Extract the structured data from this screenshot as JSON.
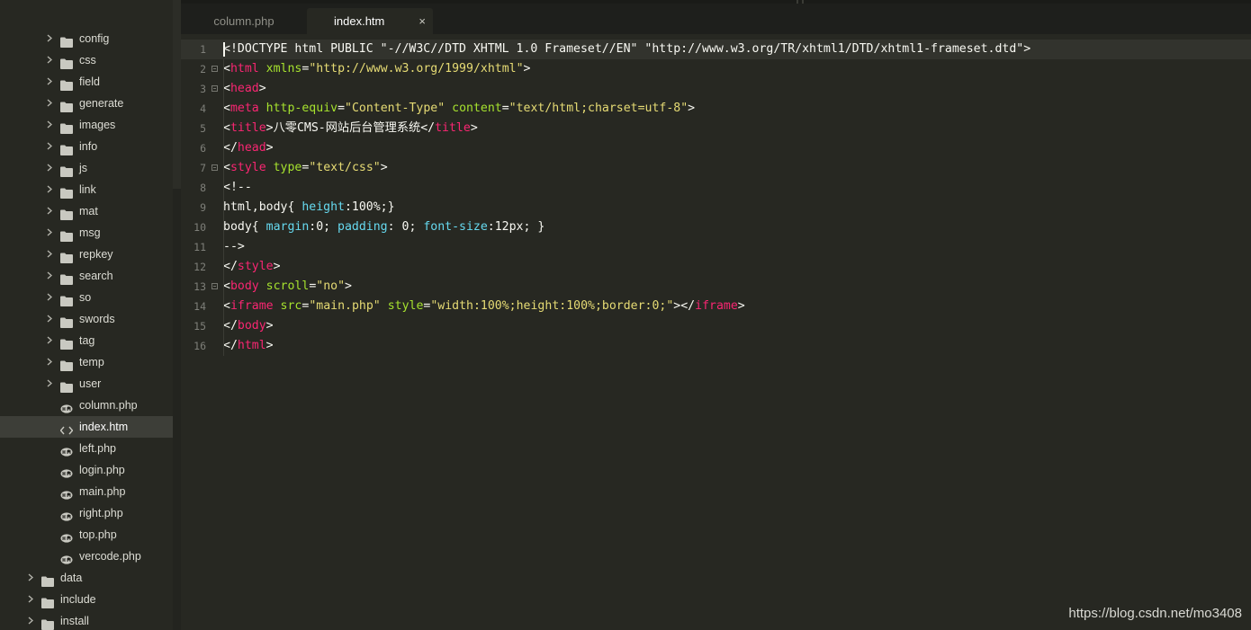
{
  "sidebar": {
    "items": [
      {
        "label": "config",
        "type": "folder",
        "depth": 1
      },
      {
        "label": "css",
        "type": "folder",
        "depth": 1
      },
      {
        "label": "field",
        "type": "folder",
        "depth": 1
      },
      {
        "label": "generate",
        "type": "folder",
        "depth": 1
      },
      {
        "label": "images",
        "type": "folder",
        "depth": 1
      },
      {
        "label": "info",
        "type": "folder",
        "depth": 1
      },
      {
        "label": "js",
        "type": "folder",
        "depth": 1
      },
      {
        "label": "link",
        "type": "folder",
        "depth": 1
      },
      {
        "label": "mat",
        "type": "folder",
        "depth": 1
      },
      {
        "label": "msg",
        "type": "folder",
        "depth": 1
      },
      {
        "label": "repkey",
        "type": "folder",
        "depth": 1
      },
      {
        "label": "search",
        "type": "folder",
        "depth": 1
      },
      {
        "label": "so",
        "type": "folder",
        "depth": 1
      },
      {
        "label": "swords",
        "type": "folder",
        "depth": 1
      },
      {
        "label": "tag",
        "type": "folder",
        "depth": 1
      },
      {
        "label": "temp",
        "type": "folder",
        "depth": 1
      },
      {
        "label": "user",
        "type": "folder",
        "depth": 1
      },
      {
        "label": "column.php",
        "type": "php",
        "depth": 1
      },
      {
        "label": "index.htm",
        "type": "html",
        "depth": 1,
        "selected": true
      },
      {
        "label": "left.php",
        "type": "php",
        "depth": 1
      },
      {
        "label": "login.php",
        "type": "php",
        "depth": 1
      },
      {
        "label": "main.php",
        "type": "php",
        "depth": 1
      },
      {
        "label": "right.php",
        "type": "php",
        "depth": 1
      },
      {
        "label": "top.php",
        "type": "php",
        "depth": 1
      },
      {
        "label": "vercode.php",
        "type": "php",
        "depth": 1
      },
      {
        "label": "data",
        "type": "folder",
        "depth": 0
      },
      {
        "label": "include",
        "type": "folder",
        "depth": 0
      },
      {
        "label": "install",
        "type": "folder",
        "depth": 0
      }
    ]
  },
  "tabs": [
    {
      "label": "column.php",
      "active": false
    },
    {
      "label": "index.htm",
      "active": true,
      "close_glyph": "×"
    }
  ],
  "editor": {
    "lines": [
      {
        "n": "1",
        "fold": false,
        "html": "&lt;!DOCTYPE html PUBLIC \"-//W3C//DTD XHTML 1.0 Frameset//EN\" \"http://www.w3.org/TR/xhtml1/DTD/xhtml1-frameset.dtd\"&gt;"
      },
      {
        "n": "2",
        "fold": true,
        "html": "&lt;<span class='t'>html</span> <span class='a'>xmlns</span>=<span class='s'>\"http://www.w3.org/1999/xhtml\"</span>&gt;"
      },
      {
        "n": "3",
        "fold": true,
        "html": "&lt;<span class='t'>head</span>&gt;"
      },
      {
        "n": "4",
        "fold": false,
        "html": "&lt;<span class='t'>meta</span> <span class='a'>http-equiv</span>=<span class='s'>\"Content-Type\"</span> <span class='a'>content</span>=<span class='s'>\"text/html;charset=utf-8\"</span>&gt;"
      },
      {
        "n": "5",
        "fold": false,
        "html": "&lt;<span class='t'>title</span>&gt;八零CMS-网站后台管理系统&lt;/<span class='t'>title</span>&gt;"
      },
      {
        "n": "6",
        "fold": false,
        "html": "&lt;/<span class='t'>head</span>&gt;"
      },
      {
        "n": "7",
        "fold": true,
        "html": "&lt;<span class='t'>style</span> <span class='a'>type</span>=<span class='s'>\"text/css\"</span>&gt;"
      },
      {
        "n": "8",
        "fold": false,
        "html": "&lt;!--"
      },
      {
        "n": "9",
        "fold": false,
        "html": "html,body{ <span class='p'>height</span>:100%;}"
      },
      {
        "n": "10",
        "fold": false,
        "html": "body{ <span class='p'>margin</span>:0; <span class='p'>padding</span>: 0; <span class='p'>font-size</span>:12px; }"
      },
      {
        "n": "11",
        "fold": false,
        "html": "--&gt;"
      },
      {
        "n": "12",
        "fold": false,
        "html": "&lt;/<span class='t'>style</span>&gt;"
      },
      {
        "n": "13",
        "fold": true,
        "html": "&lt;<span class='t'>body</span> <span class='a'>scroll</span>=<span class='s'>\"no\"</span>&gt;"
      },
      {
        "n": "14",
        "fold": false,
        "html": "&lt;<span class='t'>iframe</span> <span class='a'>src</span>=<span class='s'>\"main.php\"</span> <span class='a'>style</span>=<span class='s'>\"width:100%;height:100%;border:0;\"</span>&gt;&lt;/<span class='t'>iframe</span>&gt;"
      },
      {
        "n": "15",
        "fold": false,
        "html": "&lt;/<span class='t'>body</span>&gt;"
      },
      {
        "n": "16",
        "fold": false,
        "html": "&lt;/<span class='t'>html</span>&gt;"
      }
    ]
  },
  "watermark": "https://blog.csdn.net/mo3408"
}
